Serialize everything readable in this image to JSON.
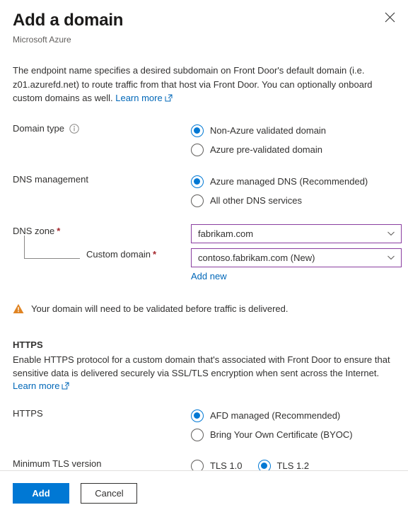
{
  "header": {
    "title": "Add a domain",
    "subtitle": "Microsoft Azure",
    "close_icon": "close-icon"
  },
  "intro": {
    "text": "The endpoint name specifies a desired subdomain on Front Door's default domain (i.e. z01.azurefd.net) to route traffic from that host via Front Door. You can optionally onboard custom domains as well. ",
    "learn_more": "Learn more",
    "external_icon": "external-link-icon"
  },
  "form": {
    "domain_type": {
      "label": "Domain type",
      "info_icon": "info-icon",
      "options": [
        {
          "label": "Non-Azure validated domain",
          "checked": true
        },
        {
          "label": "Azure pre-validated domain",
          "checked": false
        }
      ]
    },
    "dns_management": {
      "label": "DNS management",
      "options": [
        {
          "label": "Azure managed DNS (Recommended)",
          "checked": true
        },
        {
          "label": "All other DNS services",
          "checked": false
        }
      ]
    },
    "dns_zone": {
      "label": "DNS zone",
      "required": "*",
      "value": "fabrikam.com",
      "chevron_icon": "chevron-down-icon"
    },
    "custom_domain": {
      "label": "Custom domain",
      "required": "*",
      "value": "contoso.fabrikam.com (New)",
      "chevron_icon": "chevron-down-icon",
      "add_new": "Add new"
    }
  },
  "warning": {
    "icon": "warning-triangle-icon",
    "text": "Your domain will need to be validated before traffic is delivered."
  },
  "https_section": {
    "heading": "HTTPS",
    "description": "Enable HTTPS protocol for a custom domain that's associated with Front Door to ensure that sensitive data is delivered securely via SSL/TLS encryption when sent across the Internet.",
    "learn_more": "Learn more",
    "external_icon": "external-link-icon",
    "https": {
      "label": "HTTPS",
      "options": [
        {
          "label": "AFD managed (Recommended)",
          "checked": true
        },
        {
          "label": "Bring Your Own Certificate (BYOC)",
          "checked": false
        }
      ]
    },
    "tls": {
      "label": "Minimum TLS version",
      "options": [
        {
          "label": "TLS 1.0",
          "checked": false
        },
        {
          "label": "TLS 1.2",
          "checked": true
        }
      ]
    }
  },
  "footer": {
    "add_label": "Add",
    "cancel_label": "Cancel"
  },
  "colors": {
    "accent_blue": "#0078d4",
    "link_blue": "#0067b8",
    "dropdown_border": "#8a3ea0",
    "warning_orange": "#e08423",
    "required_red": "#a4262c"
  }
}
